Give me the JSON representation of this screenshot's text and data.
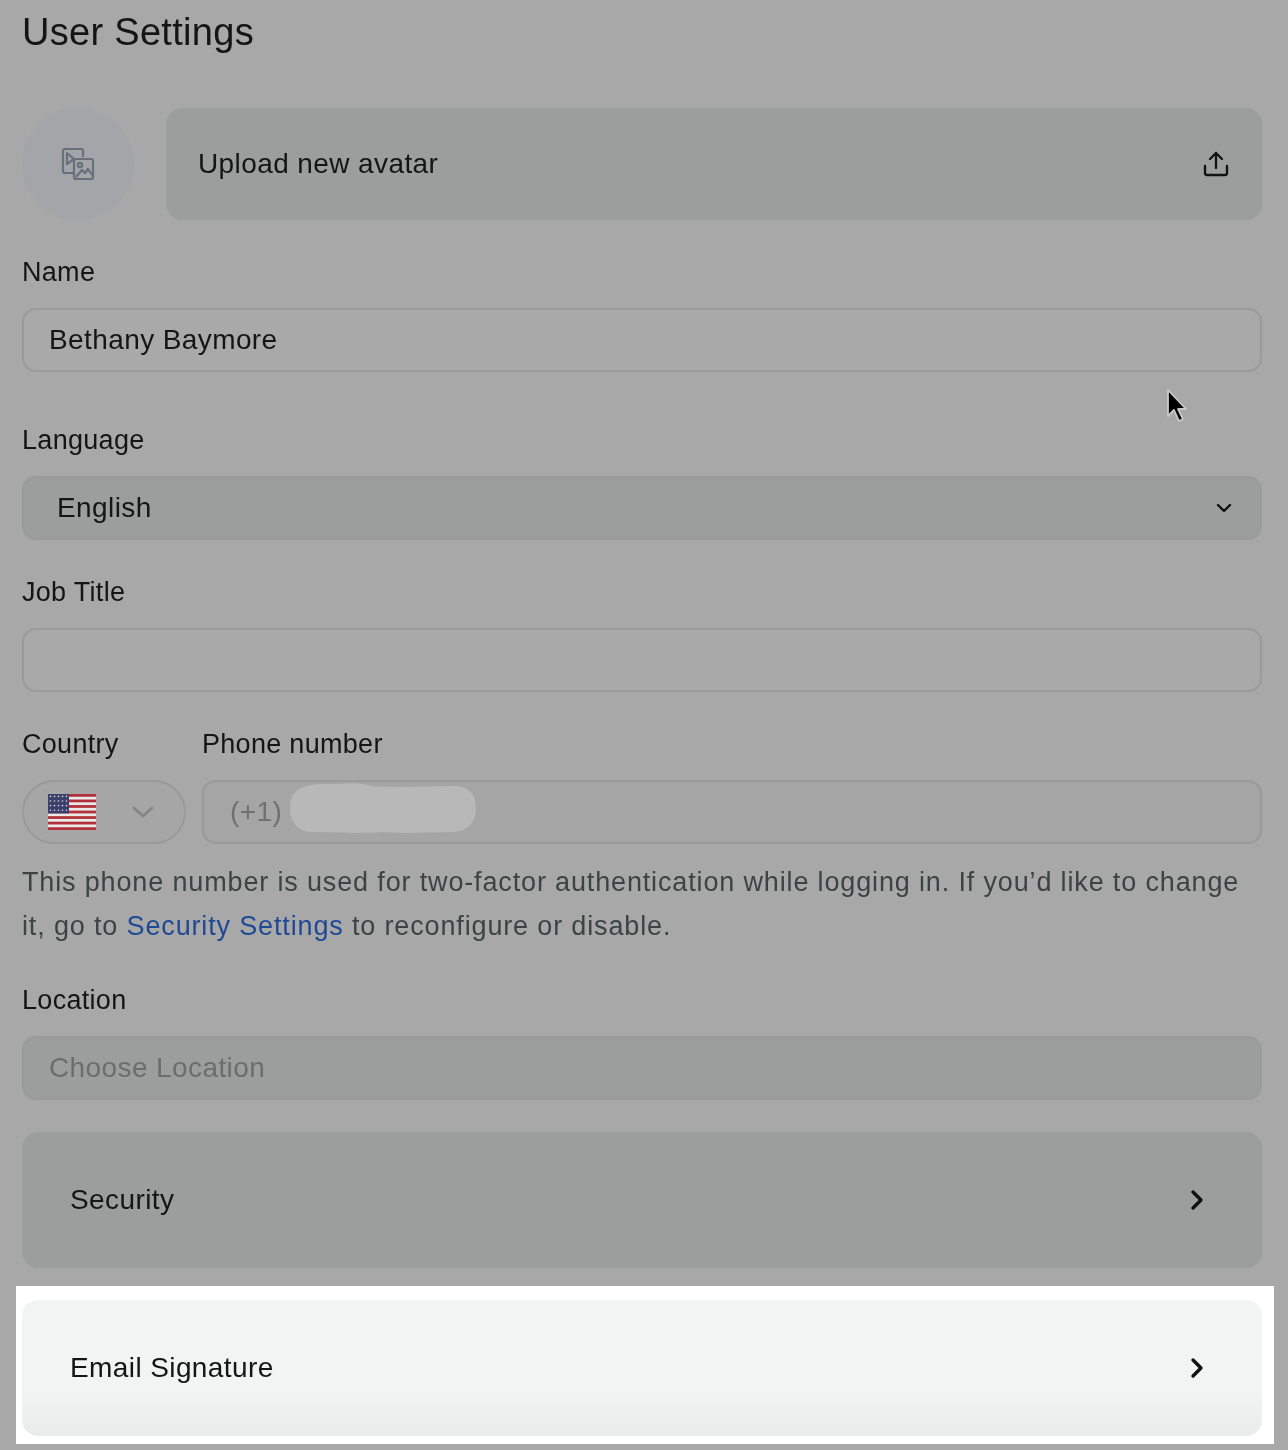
{
  "page": {
    "title": "User Settings"
  },
  "avatar": {
    "upload_label": "Upload new avatar"
  },
  "fields": [
    {
      "kind": "text",
      "label": "Name",
      "value": "Bethany Baymore"
    },
    {
      "kind": "select",
      "label": "Language",
      "value": "English"
    },
    {
      "kind": "text",
      "label": "Job Title"
    }
  ],
  "phone": {
    "country_label": "Country",
    "number_label": "Phone number",
    "prefix": "(+1)",
    "redacted": true,
    "help": {
      "before": "This phone number is used for two-factor authentication while logging in. If you’d like to change it, go to",
      "link": "Security Settings",
      "after": "to reconfigure or disable."
    }
  },
  "location": {
    "label": "Location",
    "placeholder": "Choose Location"
  },
  "links": [
    {
      "label": "Security",
      "highlighted": false
    },
    {
      "label": "Email Signature",
      "highlighted": true
    }
  ]
}
